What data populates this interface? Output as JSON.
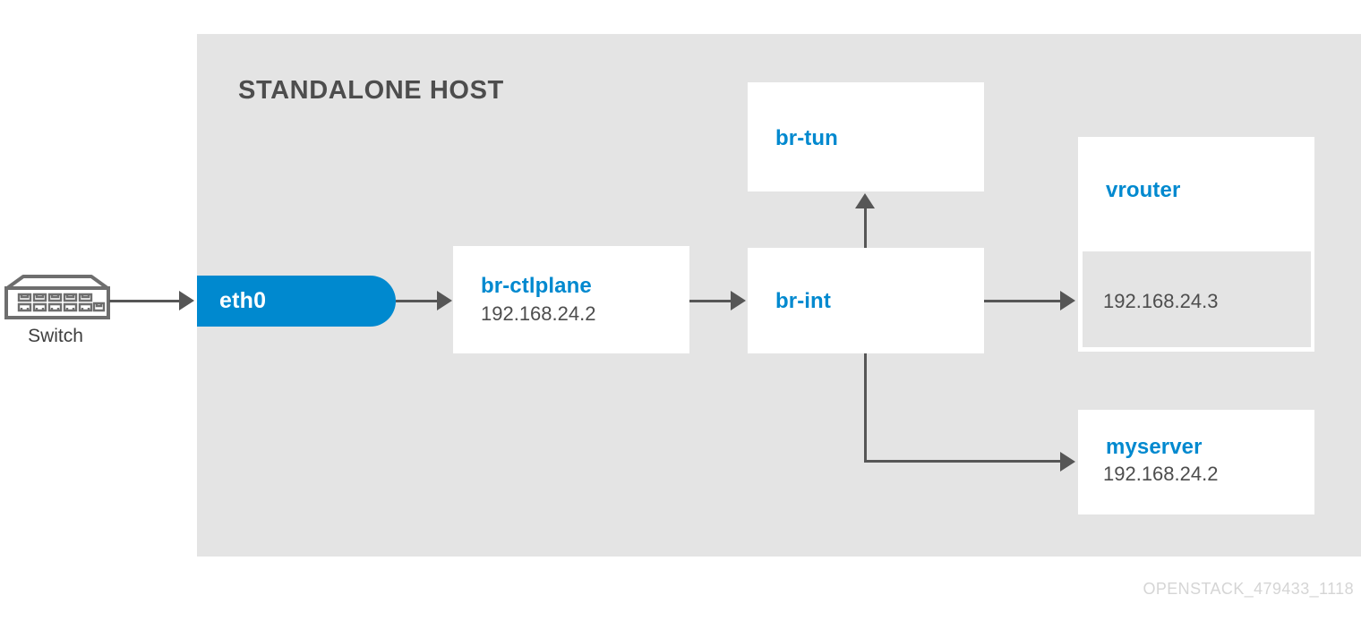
{
  "diagram": {
    "panel_title": "STANDALONE HOST",
    "watermark": "OPENSTACK_479433_1118",
    "colors": {
      "panel_bg": "#e4e4e4",
      "accent_blue": "#0089cf",
      "line_gray": "#565656",
      "title_gray": "#4d4d4d",
      "watermark_gray": "#d5d5d5",
      "box_white": "#ffffff"
    },
    "external_device": {
      "icon": "network-switch-icon",
      "label": "Switch"
    },
    "nodes": {
      "eth0": {
        "label": "eth0"
      },
      "br_ctlplane": {
        "title": "br-ctlplane",
        "ip": "192.168.24.2"
      },
      "br_tun": {
        "title": "br-tun"
      },
      "br_int": {
        "title": "br-int"
      },
      "vrouter": {
        "title": "vrouter",
        "ip": "192.168.24.3"
      },
      "myserver": {
        "title": "myserver",
        "ip": "192.168.24.2"
      }
    },
    "connections": [
      {
        "from": "Switch",
        "to": "eth0",
        "style": "arrow-right"
      },
      {
        "from": "eth0",
        "to": "br-ctlplane",
        "style": "arrow-right"
      },
      {
        "from": "br-ctlplane",
        "to": "br-int",
        "style": "arrow-right"
      },
      {
        "from": "br-int",
        "to": "br-tun",
        "style": "arrow-up"
      },
      {
        "from": "br-int",
        "to": "vrouter",
        "style": "arrow-right"
      },
      {
        "from": "br-int",
        "to": "myserver",
        "style": "elbow-down-right"
      }
    ]
  }
}
